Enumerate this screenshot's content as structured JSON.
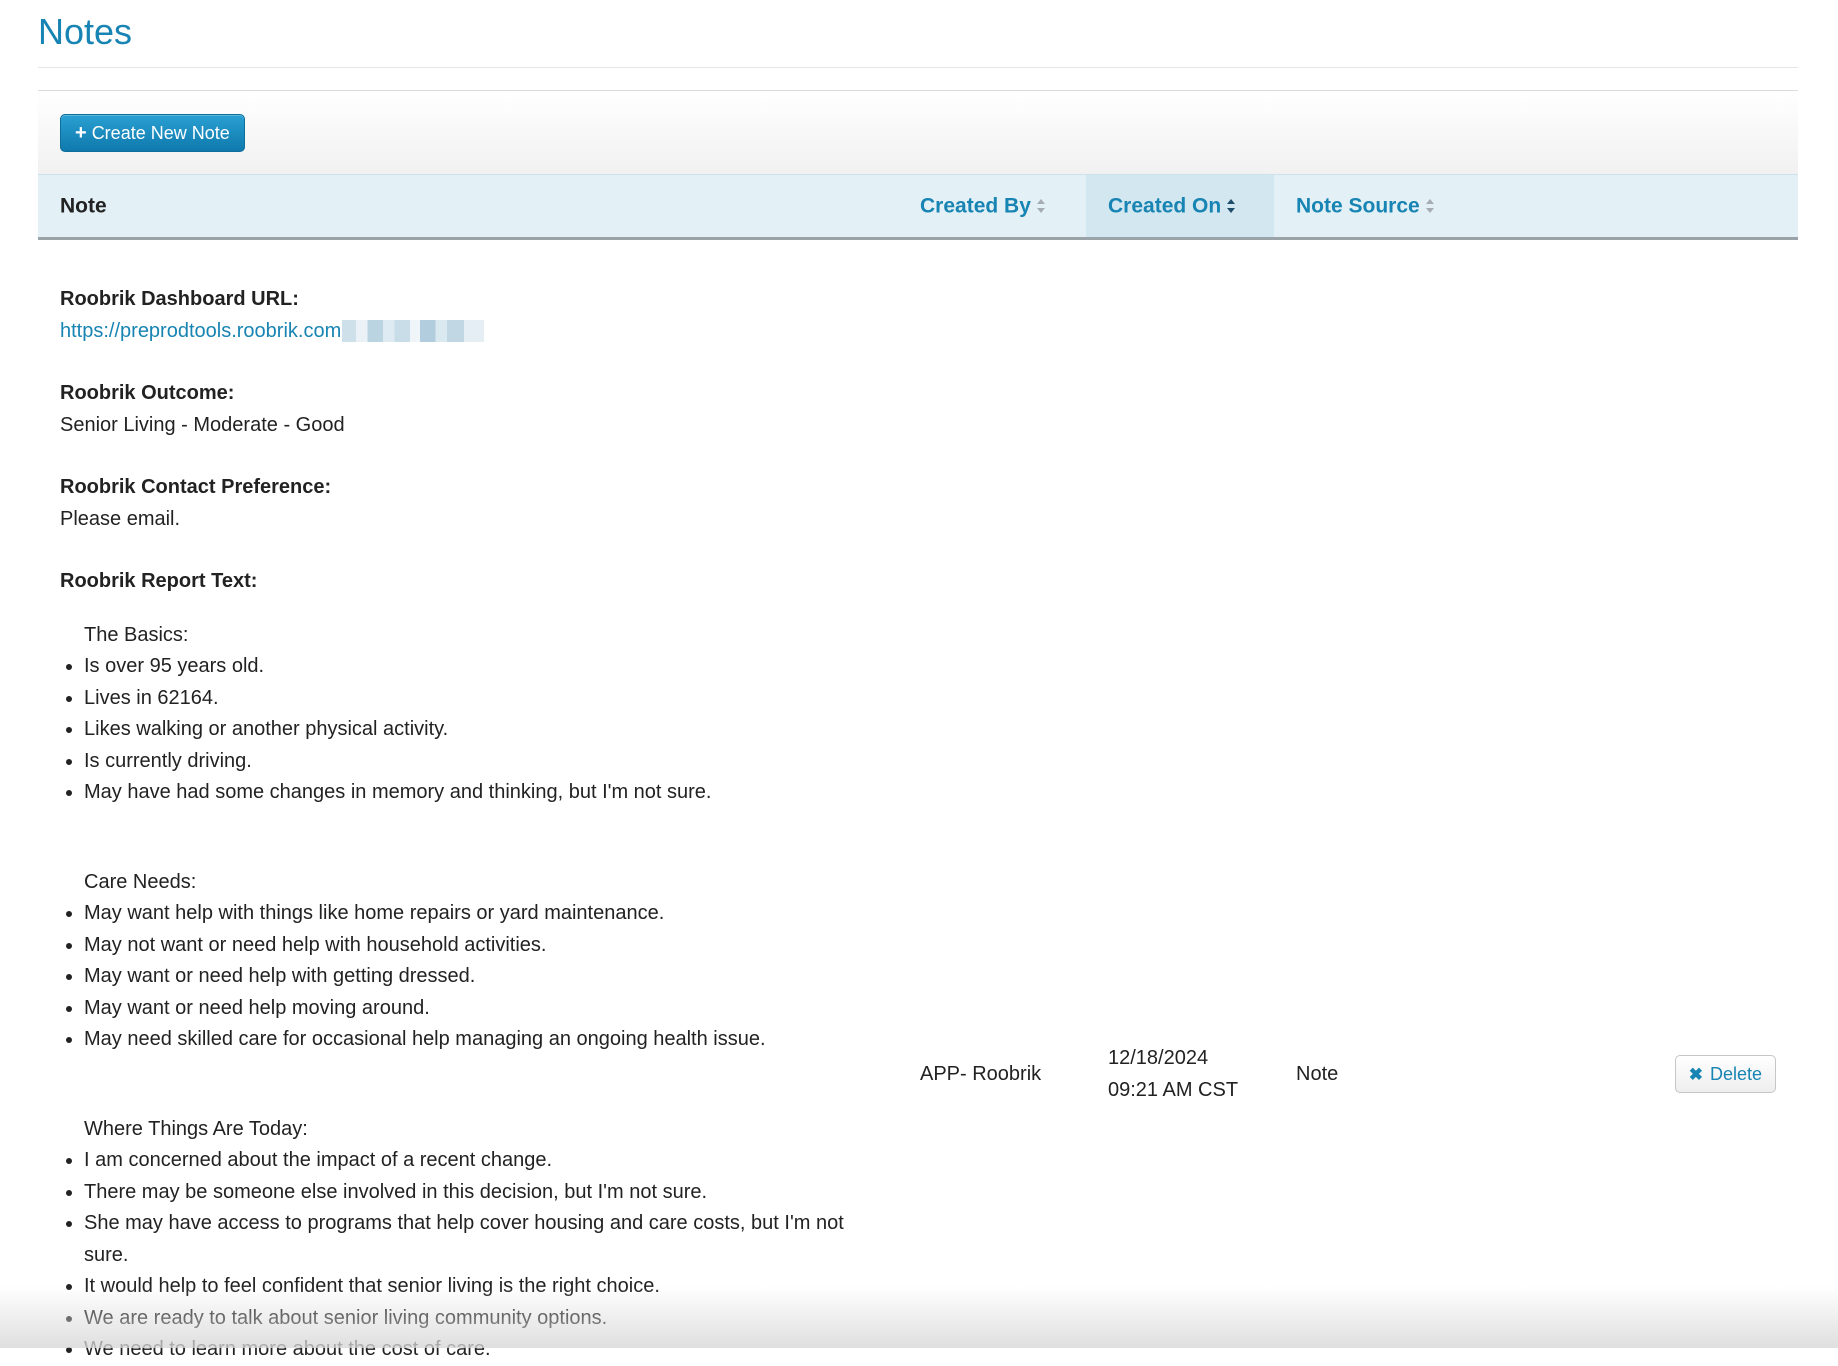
{
  "page": {
    "title": "Notes"
  },
  "toolbar": {
    "create_label": "Create New Note",
    "create_icon": "plus-icon"
  },
  "table": {
    "columns": {
      "note": "Note",
      "created_by": "Created By",
      "created_on": "Created On",
      "note_source": "Note Source"
    },
    "row": {
      "dashboard_label": "Roobrik Dashboard URL:",
      "dashboard_url": "https://preprodtools.roobrik.com",
      "outcome_label": "Roobrik Outcome:",
      "outcome_value": "Senior Living - Moderate - Good",
      "contact_label": "Roobrik Contact Preference:",
      "contact_value": "Please email.",
      "report_label": "Roobrik Report Text:",
      "sections": [
        {
          "heading": "The Basics:",
          "items": [
            "Is over 95 years old.",
            "Lives in 62164.",
            "Likes walking or another physical activity.",
            "Is currently driving.",
            "May have had some changes in memory and thinking, but I'm not sure."
          ]
        },
        {
          "heading": "Care Needs:",
          "items": [
            "May want help with things like home repairs or yard maintenance.",
            "May not want or need help with household activities.",
            "May want or need help with getting dressed.",
            "May want or need help moving around.",
            "May need skilled care for occasional help managing an ongoing health issue."
          ]
        },
        {
          "heading": "Where Things Are Today:",
          "items": [
            "I am concerned about the impact of a recent change.",
            "There may be someone else involved in this decision, but I'm not sure.",
            "She may have access to programs that help cover housing and care costs, but I'm not sure.",
            "It would help to feel confident that senior living is the right choice.",
            "We are ready to talk about senior living community options.",
            "We need to learn more about the cost of care."
          ]
        }
      ],
      "created_by": "APP- Roobrik",
      "created_on_date": "12/18/2024",
      "created_on_time": "09:21 AM CST",
      "note_source": "Note",
      "delete_label": "Delete",
      "delete_icon": "x-icon"
    }
  },
  "colors": {
    "accent": "#1784b3",
    "header_bg": "#e3f1f6",
    "button_bg": "#1a8cc1"
  }
}
